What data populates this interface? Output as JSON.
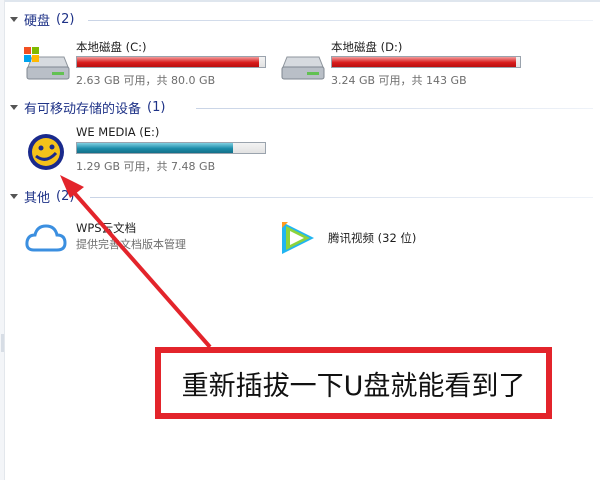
{
  "groups": {
    "hard_disks": {
      "title": "硬盘",
      "count": "(2)"
    },
    "removable": {
      "title": "有可移动存储的设备",
      "count": "(1)"
    },
    "other": {
      "title": "其他",
      "count": "(2)"
    }
  },
  "drives": [
    {
      "name": "本地磁盘 (C:)",
      "info": "2.63 GB 可用，共 80.0 GB",
      "used_fraction": 0.967,
      "bar_color": "#d81c1c",
      "icon": "windows-drive-icon"
    },
    {
      "name": "本地磁盘 (D:)",
      "info": "3.24 GB 可用，共 143 GB",
      "used_fraction": 0.977,
      "bar_color": "#d81c1c",
      "icon": "hard-drive-icon"
    },
    {
      "name": "WE MEDIA (E:)",
      "info": "1.29 GB 可用，共 7.48 GB",
      "used_fraction": 0.828,
      "bar_color": "#1c8ca9",
      "icon": "usb-drive-icon"
    }
  ],
  "other_items": [
    {
      "name": "WPS云文档",
      "desc": "提供完善文档版本管理",
      "icon": "cloud-icon"
    },
    {
      "name": "腾讯视频 (32 位)",
      "icon": "tencent-video-icon"
    }
  ],
  "annotation": {
    "text": "重新插拔一下U盘就能看到了",
    "color": "#e3242b"
  }
}
